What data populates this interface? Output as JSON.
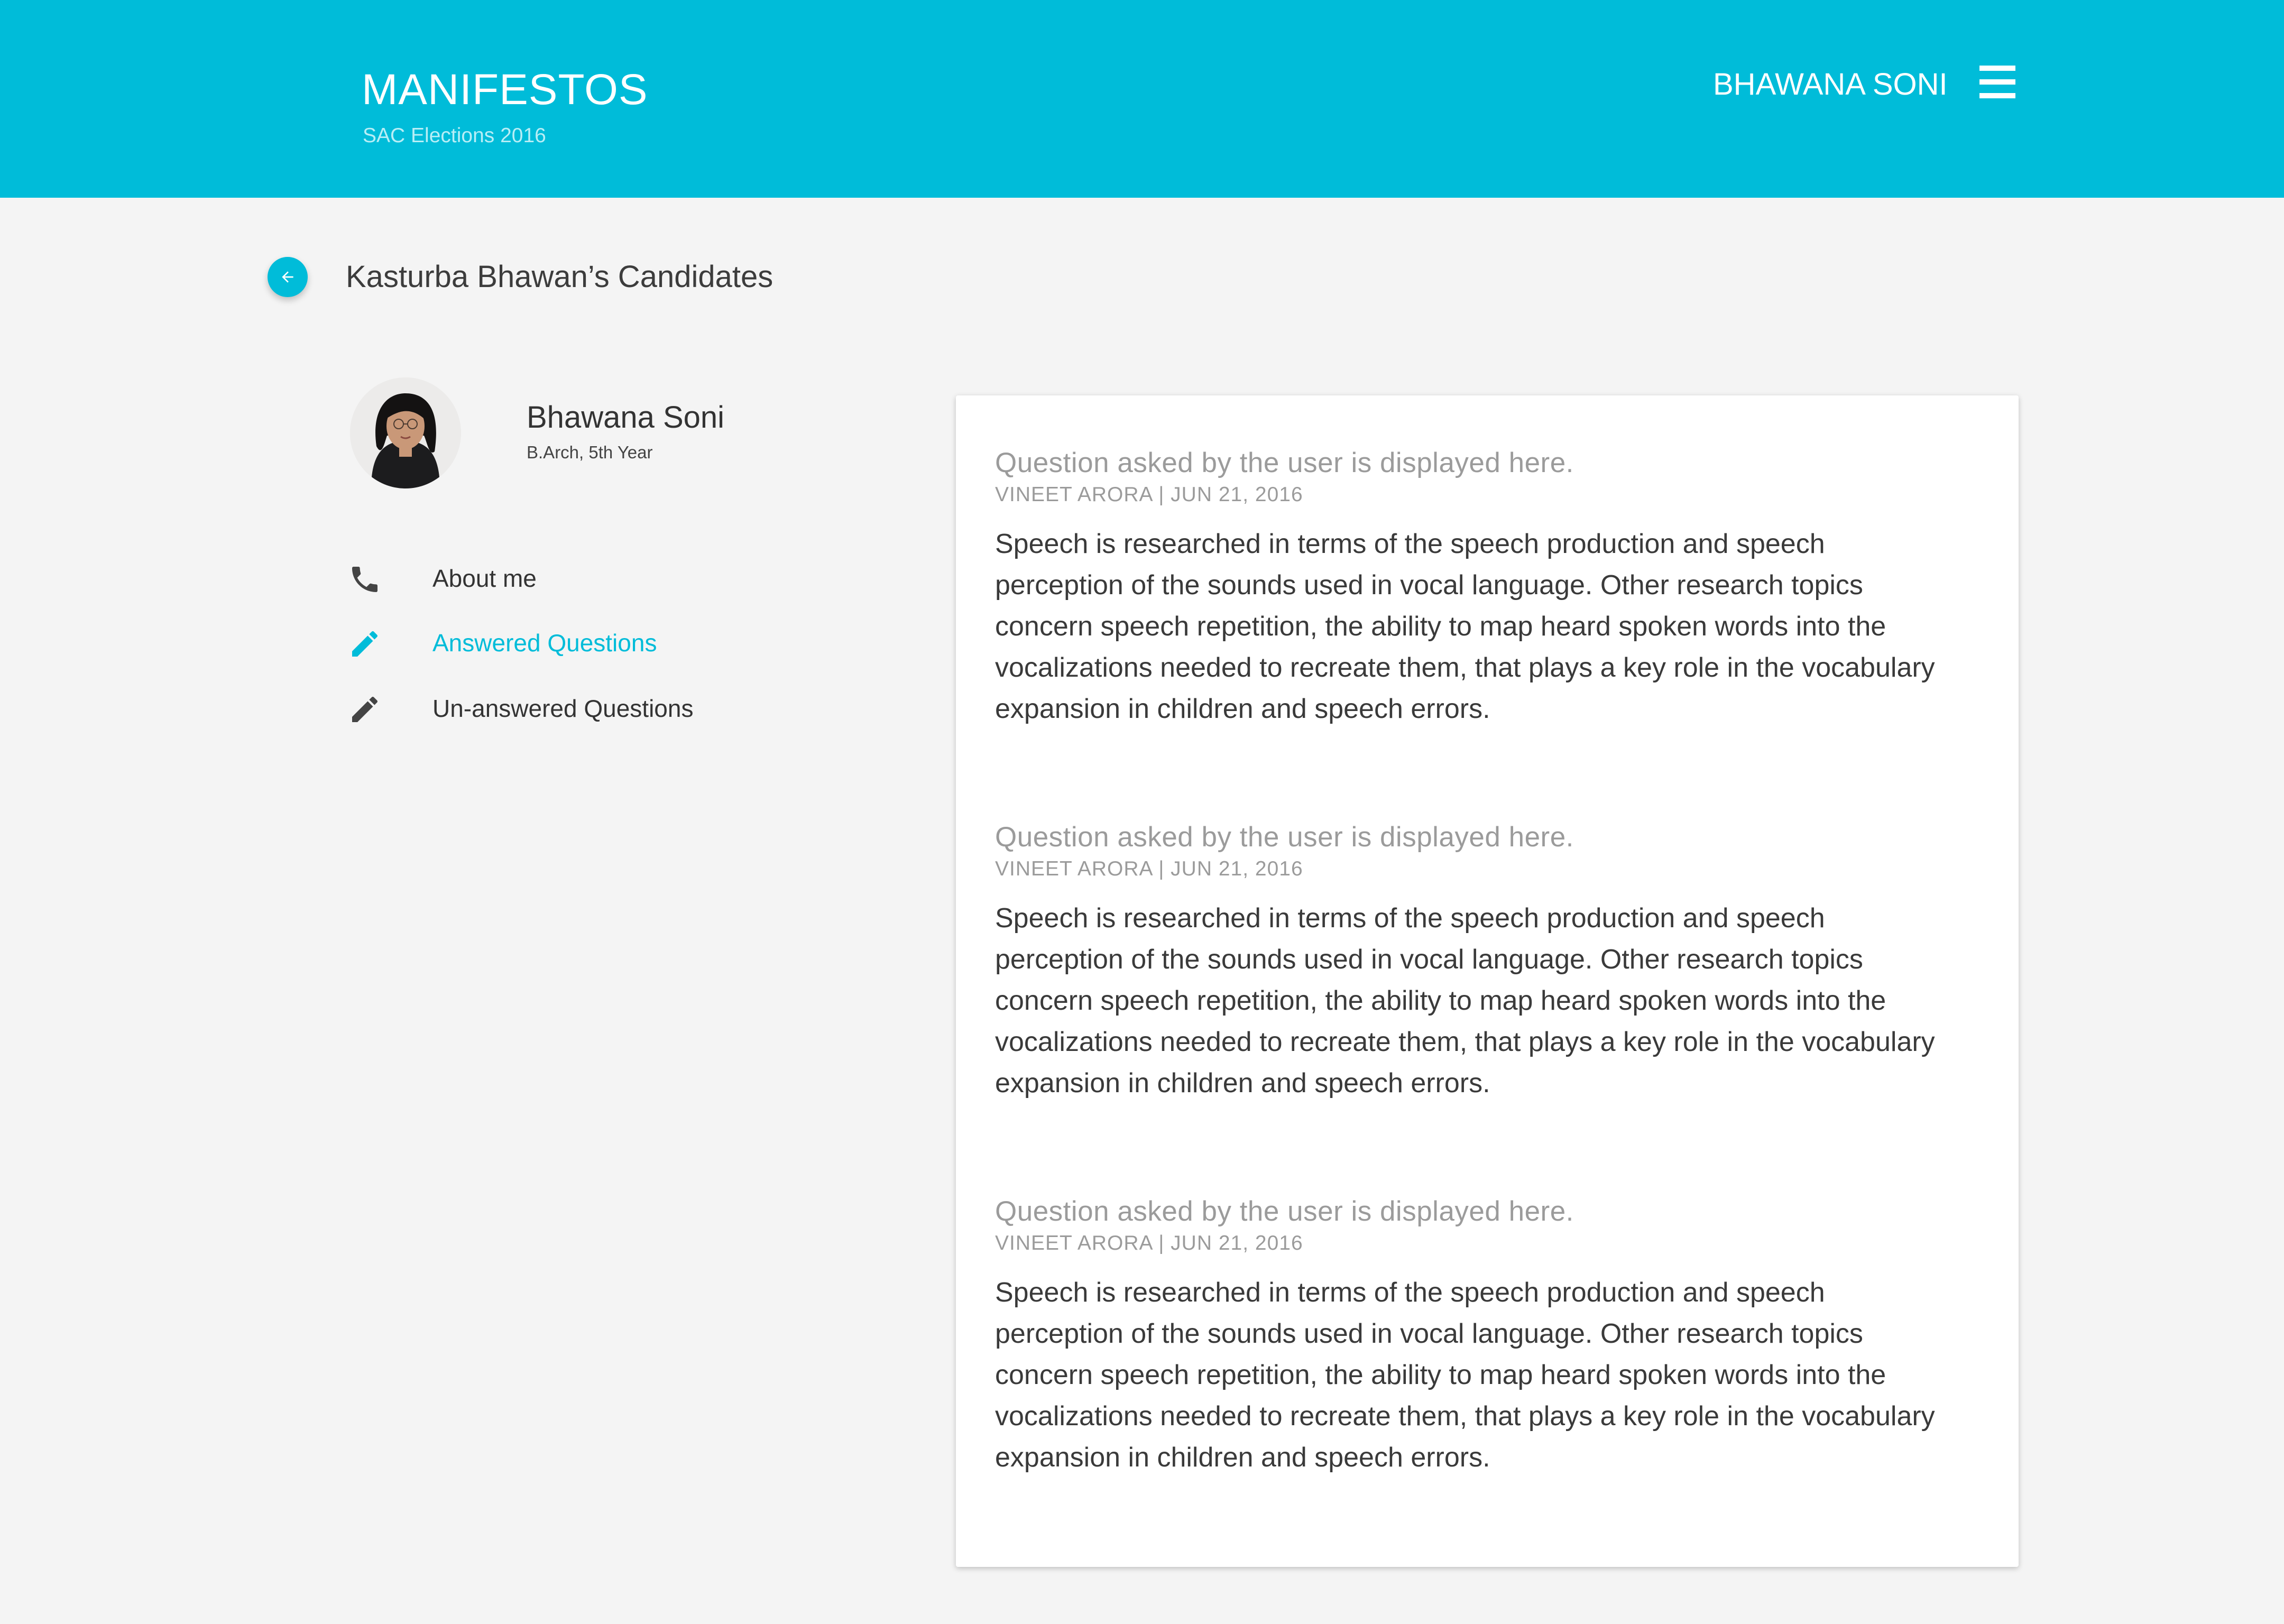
{
  "header": {
    "title": "MANIFESTOS",
    "subtitle": "SAC Elections 2016",
    "user_name": "BHAWANA SONI",
    "menu_icon": "menu-icon",
    "background": "#00bcd9"
  },
  "page": {
    "back_icon": "arrow-left-icon",
    "title": "Kasturba Bhawan’s Candidates"
  },
  "candidate": {
    "name": "Bhawana Soni",
    "details": "B.Arch, 5th Year"
  },
  "nav": {
    "items": [
      {
        "label": "About me",
        "icon": "phone-icon",
        "active": false
      },
      {
        "label": "Answered Questions",
        "icon": "pencil-icon",
        "active": true
      },
      {
        "label": "Un-answered Questions",
        "icon": "pencil-icon",
        "active": false
      }
    ]
  },
  "questions": [
    {
      "question": "Question asked by the user is displayed here.",
      "meta": "VINEET ARORA | JUN 21, 2016",
      "answer": "Speech is researched in terms of the speech production and speech perception of the sounds used in vocal language. Other research topics concern speech repetition, the ability to map heard spoken words into the vocalizations needed to recreate them, that plays a key role in the vocabulary expansion in children and speech errors."
    },
    {
      "question": "Question asked by the user is displayed here.",
      "meta": "VINEET ARORA | JUN 21, 2016",
      "answer": "Speech is researched in terms of the speech production and speech perception of the sounds used in vocal language. Other research topics concern speech repetition, the ability to map heard spoken words into the vocalizations needed to recreate them, that plays a key role in the vocabulary expansion in children and speech errors."
    },
    {
      "question": "Question asked by the user is displayed here.",
      "meta": "VINEET ARORA | JUN 21, 2016",
      "answer": "Speech is researched in terms of the speech production and speech perception of the sounds used in vocal language. Other research topics concern speech repetition, the ability to map heard spoken words into the vocalizations needed to recreate them, that plays a key role in the vocabulary expansion in children and speech errors."
    }
  ],
  "colors": {
    "accent": "#00bcd9",
    "page_background": "#f4f4f4",
    "text_primary": "#333333",
    "text_secondary": "#9b9b9b"
  }
}
